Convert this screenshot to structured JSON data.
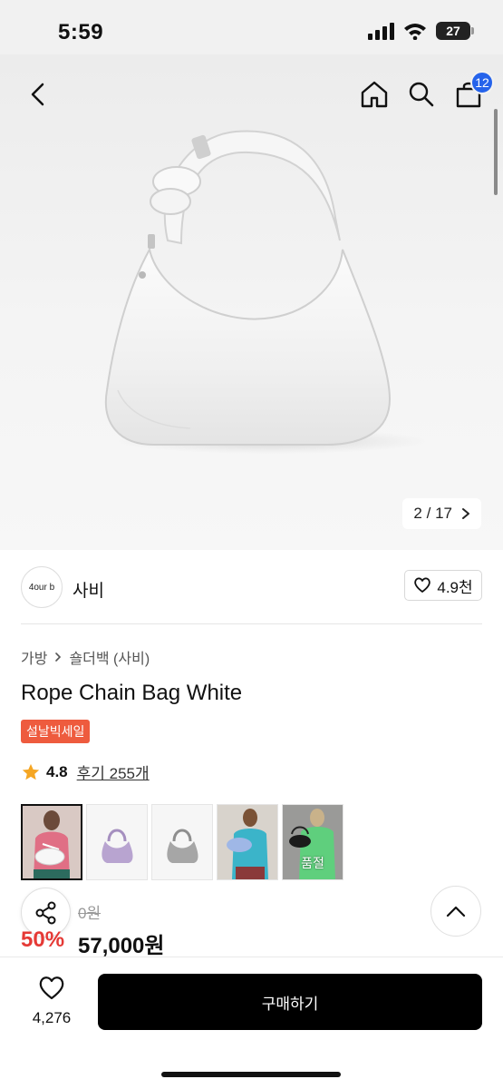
{
  "status_bar": {
    "time": "5:59",
    "battery": "27"
  },
  "header": {
    "cart_count": "12"
  },
  "gallery": {
    "current": "2",
    "separator": "/",
    "total": "17"
  },
  "brand": {
    "logo_text": "4our b",
    "name": "사비",
    "likes": "4.9천"
  },
  "breadcrumb": [
    "가방",
    "숄더백 (사비)"
  ],
  "product": {
    "title": "Rope Chain Bag White",
    "badge": "설날빅세일",
    "rating": "4.8",
    "reviews": "후기 255개"
  },
  "thumbnails": [
    {
      "label": "",
      "selected": true
    },
    {
      "label": "",
      "selected": false
    },
    {
      "label": "",
      "selected": false
    },
    {
      "label": "",
      "selected": false
    },
    {
      "label": "품절",
      "selected": false
    }
  ],
  "price": {
    "original_partial": "0원",
    "discount": "50%",
    "sale": "57,000원"
  },
  "bottom": {
    "wish_count": "4,276",
    "buy_label": "구매하기"
  },
  "colors": {
    "accent_blue": "#2563eb",
    "sale_red": "#e53935",
    "badge_orange": "#ee5b3e",
    "button_black": "#000000"
  }
}
